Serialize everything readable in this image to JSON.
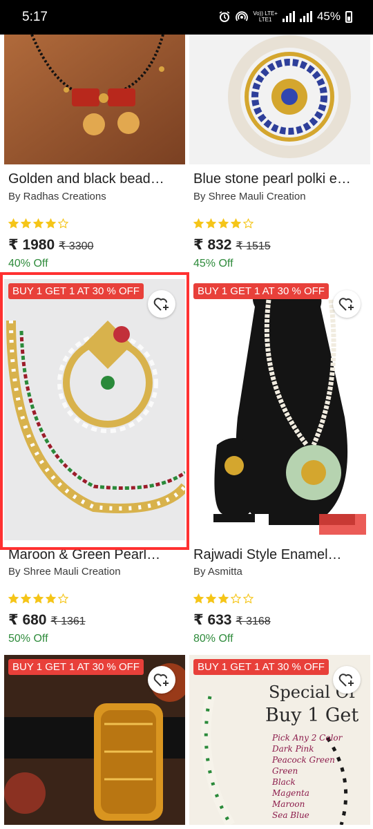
{
  "status": {
    "time": "5:17",
    "net_top": "Vo)) LTE+",
    "net_bottom": "LTE1",
    "battery": "45%"
  },
  "cards": [
    {
      "title": "Golden and black bead…",
      "seller": "By Radhas Creations",
      "rating": 4,
      "price": "₹ 1980",
      "mrp": "₹ 3300",
      "discount": "40% Off"
    },
    {
      "title": "Blue stone pearl polki e…",
      "seller": "By Shree Mauli Creation",
      "rating": 4,
      "price": "₹ 832",
      "mrp": "₹ 1515",
      "discount": "45% Off"
    },
    {
      "badge": "BUY 1 GET 1 AT 30 % OFF",
      "title": "Maroon & Green Pearl…",
      "seller": "By Shree Mauli Creation",
      "rating": 4,
      "price": "₹ 680",
      "mrp": "₹ 1361",
      "discount": "50% Off"
    },
    {
      "badge": "BUY 1 GET 1 AT 30 % OFF",
      "title": "Rajwadi Style Enamel…",
      "seller": "By Asmitta",
      "rating": 3,
      "price": "₹ 633",
      "mrp": "₹ 3168",
      "discount": "80% Off"
    },
    {
      "badge": "BUY 1 GET 1 AT 30 % OFF"
    },
    {
      "badge": "BUY 1 GET 1 AT 30 % OFF",
      "poster": {
        "line1": "Special Of",
        "line2": "Buy 1 Get",
        "items": [
          "Pick Any 2 Color",
          "Dark Pink",
          "Peacock Green",
          "Green",
          "Black",
          "Magenta",
          "Maroon",
          "Sea Blue"
        ]
      }
    }
  ],
  "colors": {
    "badge": "#e8403a",
    "discount": "#2e8b3b",
    "star": "#f5c518",
    "highlight": "#ff3131"
  }
}
